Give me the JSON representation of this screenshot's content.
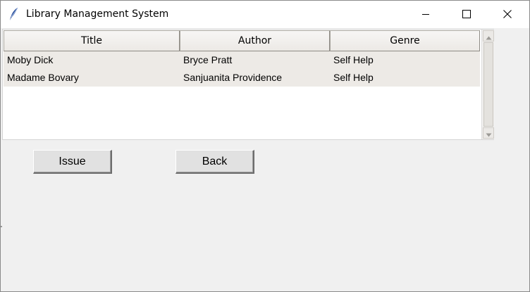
{
  "window": {
    "title": "Library Management System",
    "icon": "feather-icon",
    "controls": [
      "minimize-icon",
      "maximize-icon",
      "close-icon"
    ]
  },
  "table": {
    "columns": [
      "Title",
      "Author",
      "Genre"
    ],
    "rows": [
      [
        "Moby Dick",
        "Bryce Pratt",
        "Self Help"
      ],
      [
        "Madame Bovary",
        "Sanjuanita Providence",
        "Self Help"
      ]
    ]
  },
  "buttons": {
    "issue_label": "Issue",
    "back_label": "Back"
  },
  "colors": {
    "window_bg": "#f0f0f0",
    "row_bg": "#edeae6",
    "header_bg": "#ece9e5"
  }
}
